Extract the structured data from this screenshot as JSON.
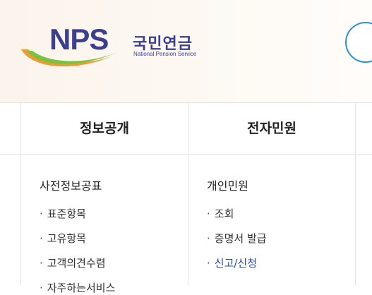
{
  "header": {
    "logo": {
      "mark_text": "NPS",
      "name_kr": "국민연금",
      "name_en": "National Pension Service"
    },
    "circle_button_icon": "circle-button-icon"
  },
  "menu": {
    "tabs": [
      {
        "label": ""
      },
      {
        "label": "정보공개"
      },
      {
        "label": "전자민원"
      }
    ]
  },
  "columns": [
    {
      "title": "사전정보공표",
      "items": [
        {
          "label": "표준항목"
        },
        {
          "label": "고유항목"
        },
        {
          "label": "고객의견수렴"
        },
        {
          "label": "자주하는서비스"
        }
      ]
    },
    {
      "title": "개인민원",
      "items": [
        {
          "label": "조회"
        },
        {
          "label": "증명서 발급"
        },
        {
          "label": "신고/신청"
        }
      ]
    }
  ],
  "colors": {
    "logo_navy": "#3b3f8f",
    "logo_green": "#7cc242",
    "logo_orange": "#f29a2e",
    "active_link": "#2a4aa8",
    "circle_border": "#2c8fd9"
  },
  "bullet": "·"
}
